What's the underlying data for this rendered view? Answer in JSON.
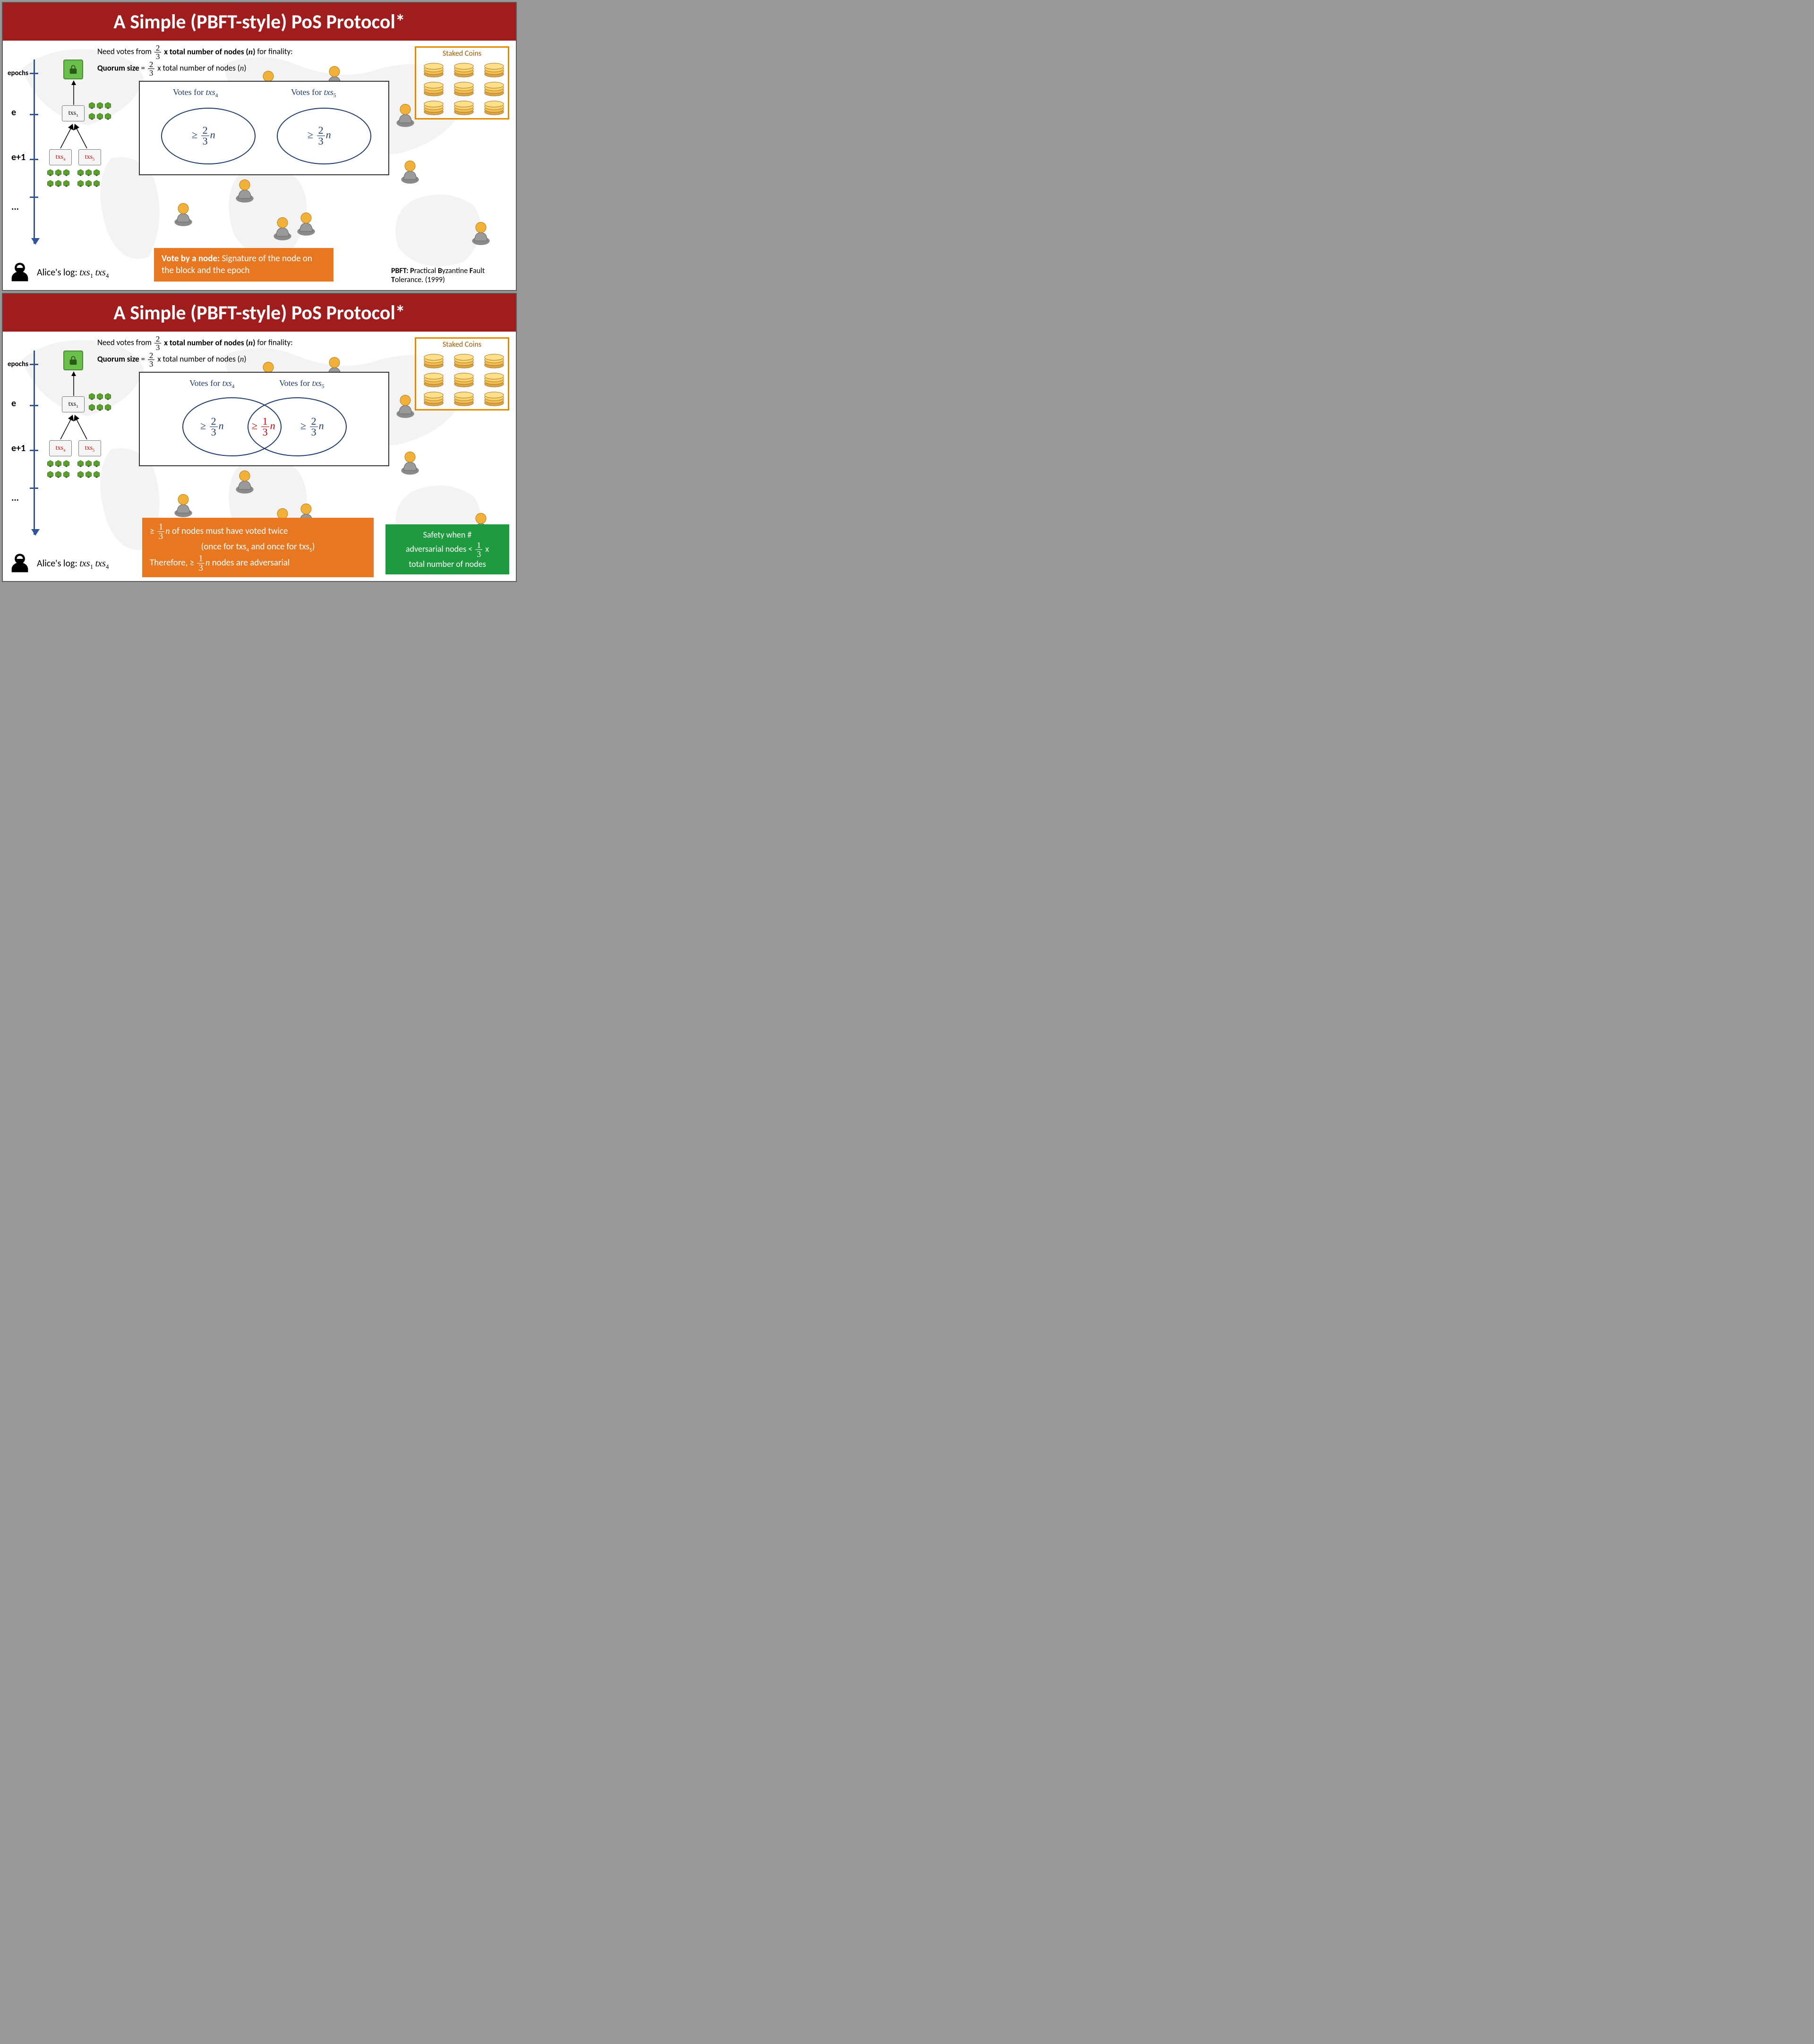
{
  "title": "A Simple (PBFT-style) PoS Protocol*",
  "top_text": {
    "line1_pre": "Need votes from ",
    "frac_num": "2",
    "frac_den": "3",
    "line1_post_bold": "x total number of nodes (",
    "line1_post_bold_n": "n",
    "line1_post_bold_end": ") ",
    "line1_tail": "for finality:",
    "line2_bold": "Quorum size",
    "line2_eq": " = ",
    "line2_tail": "x total number of nodes (",
    "line2_n": "n",
    "line2_end": ")"
  },
  "epochs_label": "epochs",
  "e_labels": {
    "e": "e",
    "e1": "e+1",
    "dots": "..."
  },
  "txs": {
    "t1": "txs",
    "t1s": "1",
    "t4": "txs",
    "t4s": "4",
    "t5": "txs",
    "t5s": "5"
  },
  "votes_panel": {
    "label4_pre": "Votes for ",
    "label4_t": "txs",
    "label4_s": "4",
    "label5_pre": "Votes for ",
    "label5_t": "txs",
    "label5_s": "5",
    "ge": "≥",
    "frac_num": "2",
    "frac_den": "3",
    "n": "n",
    "mid_num": "1",
    "mid_den": "3"
  },
  "staked": "Staked Coins",
  "orange1": {
    "bold": "Vote by a node: ",
    "rest": "Signature of the node on the block and the epoch"
  },
  "pbft": {
    "bold1": "PBFT: P",
    "mid1": "ractical ",
    "bold2": "B",
    "mid2": "yzantine ",
    "bold3": "F",
    "mid3": "ault ",
    "bold4": "T",
    "mid4": "olerance. (1999)"
  },
  "alice_pre": "Alice's log: ",
  "orange2_l1_pre": "≥ ",
  "orange2_l1_num": "1",
  "orange2_l1_den": "3",
  "orange2_l1_mid": "n",
  "orange2_l1_post": " of nodes must have voted twice",
  "orange2_l2_pre": "(once for txs",
  "orange2_l2_s4": "4",
  "orange2_l2_mid": " and once for txs",
  "orange2_l2_s5": "5",
  "orange2_l2_end": ")",
  "orange2_l3_pre": "Therefore,  ≥ ",
  "orange2_l3_num": "1",
  "orange2_l3_den": "3",
  "orange2_l3_mid": "n",
  "orange2_l3_post": " nodes are adversarial",
  "green_l1": "Safety when #",
  "green_l2_pre": "adversarial nodes < ",
  "green_l2_num": "1",
  "green_l2_den": "3",
  "green_l2_post": " x",
  "green_l3": "total number of nodes"
}
